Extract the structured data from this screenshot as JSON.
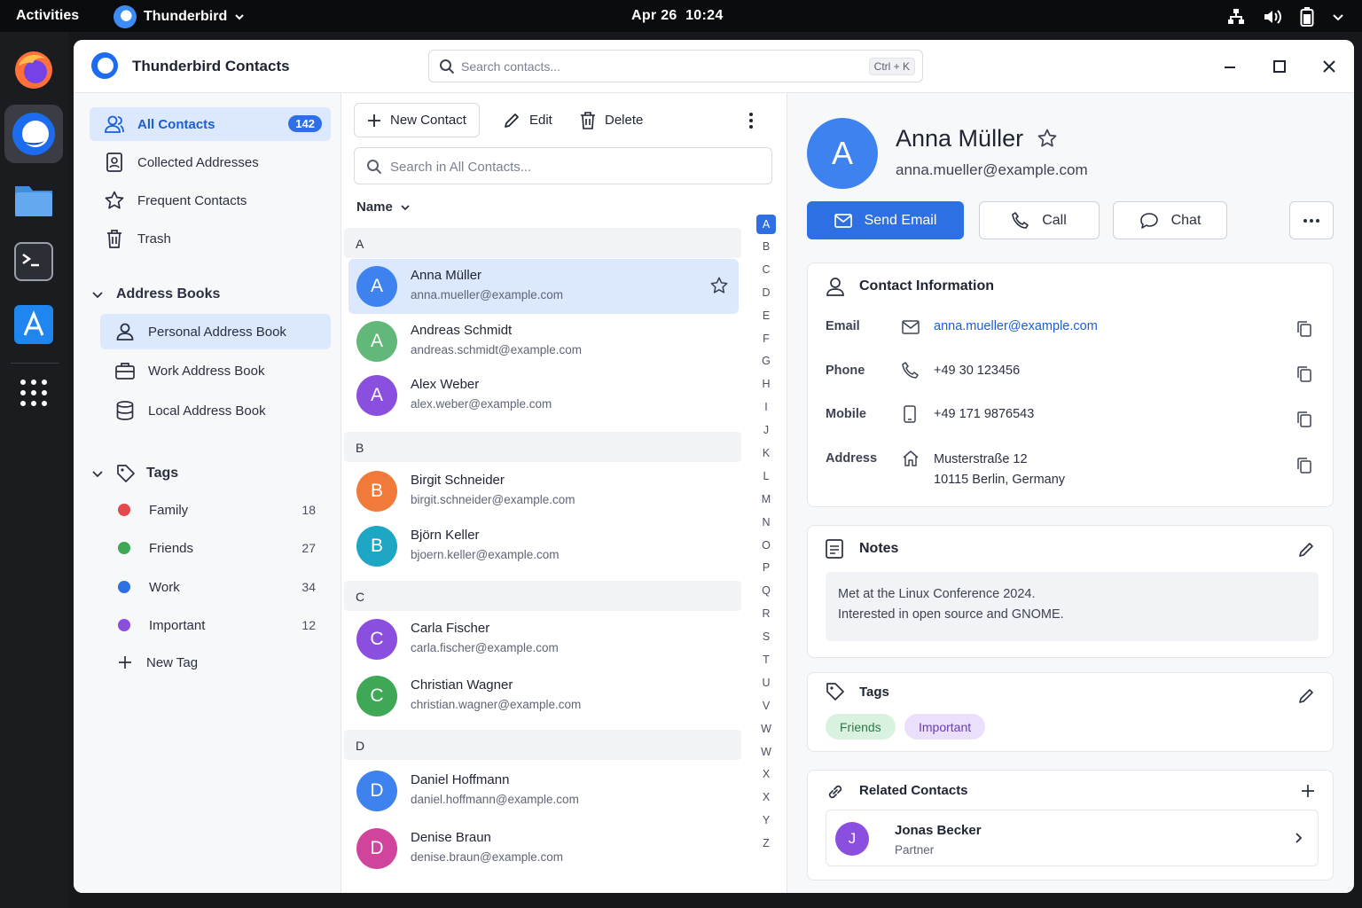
{
  "topbar": {
    "activities": "Activities",
    "app_name": "Thunderbird",
    "date": "Apr 26",
    "time": "10:24"
  },
  "dock": {
    "items": [
      "firefox-icon",
      "thunderbird-icon",
      "files-icon",
      "terminal-icon",
      "software-icon",
      "app-grid-icon"
    ]
  },
  "window": {
    "title": "Thunderbird Contacts",
    "search_placeholder": "Search contacts...",
    "search_shortcut": "Ctrl + K"
  },
  "sidebar": {
    "nav": [
      {
        "label": "All Contacts",
        "count": "142",
        "icon": "contacts-icon"
      },
      {
        "label": "Collected Addresses",
        "icon": "collected-icon"
      },
      {
        "label": "Frequent Contacts",
        "icon": "star-icon"
      },
      {
        "label": "Trash",
        "icon": "trash-icon"
      }
    ],
    "address_books_title": "Address Books",
    "address_books": [
      {
        "label": "Personal Address Book",
        "icon": "person-icon"
      },
      {
        "label": "Work Address Book",
        "icon": "briefcase-icon"
      },
      {
        "label": "Local Address Book",
        "icon": "database-icon"
      }
    ],
    "tags_title": "Tags",
    "tags": [
      {
        "label": "Family",
        "count": "18",
        "color": "#e5484d"
      },
      {
        "label": "Friends",
        "count": "27",
        "color": "#3ea856"
      },
      {
        "label": "Work",
        "count": "34",
        "color": "#2f6fe4"
      },
      {
        "label": "Important",
        "count": "12",
        "color": "#8b4fe0"
      }
    ],
    "new_tag": "New Tag"
  },
  "list": {
    "toolbar": {
      "new_contact": "New Contact",
      "edit": "Edit",
      "delete": "Delete"
    },
    "search_placeholder": "Search in All Contacts...",
    "sort_label": "Name",
    "groups": [
      {
        "letter": "A",
        "contacts": [
          {
            "initial": "A",
            "name": "Anna Müller",
            "email": "anna.mueller@example.com",
            "color": "#3d82ef"
          },
          {
            "initial": "A",
            "name": "Andreas Schmidt",
            "email": "andreas.schmidt@example.com",
            "color": "#62b879"
          },
          {
            "initial": "A",
            "name": "Alex Weber",
            "email": "alex.weber@example.com",
            "color": "#8b4fe0"
          }
        ]
      },
      {
        "letter": "B",
        "contacts": [
          {
            "initial": "B",
            "name": "Birgit Schneider",
            "email": "birgit.schneider@example.com",
            "color": "#f07a3a"
          },
          {
            "initial": "B",
            "name": "Björn Keller",
            "email": "bjoern.keller@example.com",
            "color": "#1ea7c4"
          }
        ]
      },
      {
        "letter": "C",
        "contacts": [
          {
            "initial": "C",
            "name": "Carla Fischer",
            "email": "carla.fischer@example.com",
            "color": "#8b4fe0"
          },
          {
            "initial": "C",
            "name": "Christian Wagner",
            "email": "christian.wagner@example.com",
            "color": "#3ea856"
          }
        ]
      },
      {
        "letter": "D",
        "contacts": [
          {
            "initial": "D",
            "name": "Daniel Hoffmann",
            "email": "daniel.hoffmann@example.com",
            "color": "#3d82ef"
          },
          {
            "initial": "D",
            "name": "Denise Braun",
            "email": "denise.braun@example.com",
            "color": "#d0449c"
          }
        ]
      }
    ],
    "alphabet": [
      "A",
      "B",
      "C",
      "D",
      "E",
      "F",
      "G",
      "H",
      "I",
      "J",
      "K",
      "L",
      "M",
      "N",
      "O",
      "P",
      "Q",
      "R",
      "S",
      "T",
      "U",
      "V",
      "W",
      "W",
      "X",
      "X",
      "Y",
      "Z"
    ]
  },
  "detail": {
    "initial": "A",
    "name": "Anna Müller",
    "email": "anna.mueller@example.com",
    "actions": {
      "send_email": "Send Email",
      "call": "Call",
      "chat": "Chat"
    },
    "contact_info": {
      "title": "Contact Information",
      "email_label": "Email",
      "email": "anna.mueller@example.com",
      "phone_label": "Phone",
      "phone": "+49 30 123456",
      "mobile_label": "Mobile",
      "mobile": "+49 171 9876543",
      "address_label": "Address",
      "address_line1": "Musterstraße 12",
      "address_line2": "10115 Berlin, Germany"
    },
    "notes": {
      "title": "Notes",
      "line1": "Met at the Linux Conference 2024.",
      "line2": "Interested in open source and GNOME."
    },
    "tags": {
      "title": "Tags",
      "items": [
        {
          "label": "Friends",
          "bg": "#d9f2df",
          "fg": "#2d7a45"
        },
        {
          "label": "Important",
          "bg": "#ebe0fb",
          "fg": "#6a3bb8"
        }
      ]
    },
    "related": {
      "title": "Related Contacts",
      "items": [
        {
          "initial": "J",
          "name": "Jonas Becker",
          "role": "Partner"
        }
      ]
    }
  },
  "colors": {
    "accent": "#2f6fe4",
    "selection": "#dce8fd"
  }
}
